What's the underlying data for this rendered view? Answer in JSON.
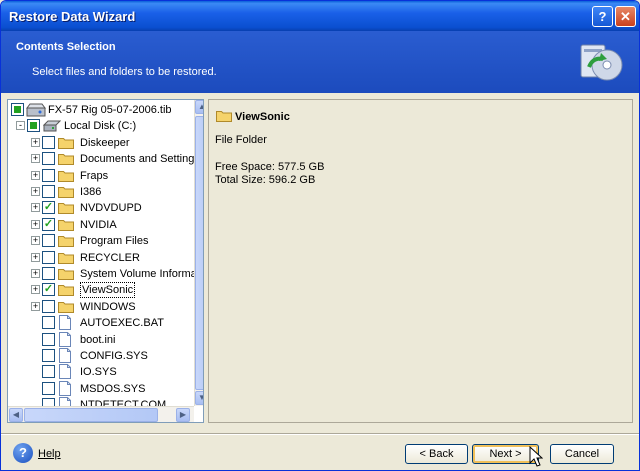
{
  "window": {
    "title": "Restore Data Wizard"
  },
  "titlebar": {
    "help_label": "?",
    "close_label": "✕"
  },
  "banner": {
    "heading": "Contents Selection",
    "subtitle": "Select files and folders to be restored."
  },
  "tree": {
    "items": [
      {
        "label": "FX-57 Rig 05-07-2006.tib",
        "kind": "archive",
        "checked": "partial",
        "expander": ""
      },
      {
        "label": "Local Disk (C:)",
        "kind": "disk",
        "checked": "partial",
        "expander": "-"
      },
      {
        "label": "Diskeeper",
        "kind": "folder",
        "checked": "none",
        "expander": "+"
      },
      {
        "label": "Documents and Settings",
        "kind": "folder",
        "checked": "none",
        "expander": "+"
      },
      {
        "label": "Fraps",
        "kind": "folder",
        "checked": "none",
        "expander": "+"
      },
      {
        "label": "I386",
        "kind": "folder",
        "checked": "none",
        "expander": "+"
      },
      {
        "label": "NVDVDUPD",
        "kind": "folder",
        "checked": "checked",
        "expander": "+"
      },
      {
        "label": "NVIDIA",
        "kind": "folder",
        "checked": "checked",
        "expander": "+"
      },
      {
        "label": "Program Files",
        "kind": "folder",
        "checked": "none",
        "expander": "+"
      },
      {
        "label": "RECYCLER",
        "kind": "folder",
        "checked": "none",
        "expander": "+"
      },
      {
        "label": "System Volume Informa",
        "kind": "folder",
        "checked": "none",
        "expander": "+"
      },
      {
        "label": "ViewSonic",
        "kind": "folder",
        "checked": "checked",
        "expander": "+",
        "selected": true
      },
      {
        "label": "WINDOWS",
        "kind": "folder",
        "checked": "none",
        "expander": "+"
      },
      {
        "label": "AUTOEXEC.BAT",
        "kind": "file",
        "checked": "none",
        "expander": ""
      },
      {
        "label": "boot.ini",
        "kind": "file",
        "checked": "none",
        "expander": ""
      },
      {
        "label": "CONFIG.SYS",
        "kind": "file",
        "checked": "none",
        "expander": ""
      },
      {
        "label": "IO.SYS",
        "kind": "file",
        "checked": "none",
        "expander": ""
      },
      {
        "label": "MSDOS.SYS",
        "kind": "file",
        "checked": "none",
        "expander": ""
      },
      {
        "label": "NTDETECT.COM",
        "kind": "file",
        "checked": "none",
        "expander": ""
      }
    ]
  },
  "detail": {
    "name": "ViewSonic",
    "type": "File Folder",
    "free_space": "Free Space: 577.5 GB",
    "total_size": "Total Size: 596.2 GB"
  },
  "footer": {
    "help_label": "Help",
    "back_label": "< Back",
    "next_label": "Next >",
    "cancel_label": "Cancel"
  },
  "colors": {
    "titlebar": "#0a4fd0",
    "banner": "#2a5dd1",
    "checkmark": "#21a121",
    "folder": "#f5d36b"
  }
}
